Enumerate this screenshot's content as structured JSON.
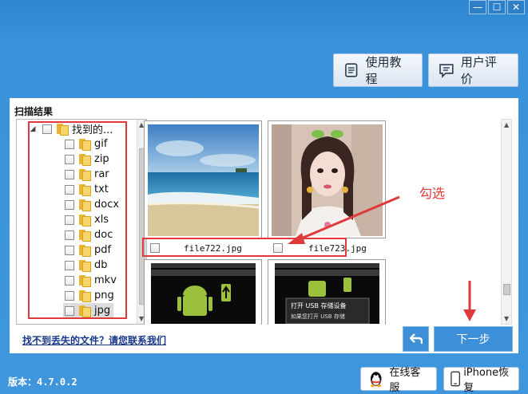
{
  "window": {
    "minimize_label": "—",
    "maximize_label": "☐",
    "close_label": "✕"
  },
  "header": {
    "tutorial_label": "使用教程",
    "review_label": "用户评价"
  },
  "scan": {
    "title": "扫描结果",
    "tree": [
      {
        "label": "找到的...",
        "root": true
      },
      {
        "label": "gif"
      },
      {
        "label": "zip"
      },
      {
        "label": "rar"
      },
      {
        "label": "txt"
      },
      {
        "label": "docx"
      },
      {
        "label": "xls"
      },
      {
        "label": "doc"
      },
      {
        "label": "pdf"
      },
      {
        "label": "db"
      },
      {
        "label": "mkv"
      },
      {
        "label": "png"
      },
      {
        "label": "jpg",
        "selected": true
      }
    ],
    "files": [
      {
        "name": "file722.jpg"
      },
      {
        "name": "file723.jpg"
      }
    ],
    "thumb_texts": {
      "android2_banner": "打开 USB 存储设备",
      "android2_sub": "如果您打开 USB 存储"
    },
    "annotation": "勾选"
  },
  "footer": {
    "help_link": "找不到丢失的文件？请您联系我们",
    "next_label": "下一步",
    "version": "版本：4.7.0.2",
    "online_service": "在线客服",
    "iphone_restore": "iPhone恢复"
  },
  "colors": {
    "accent": "#3d8fd8",
    "annotation": "#e0393b",
    "link": "#17378a"
  }
}
